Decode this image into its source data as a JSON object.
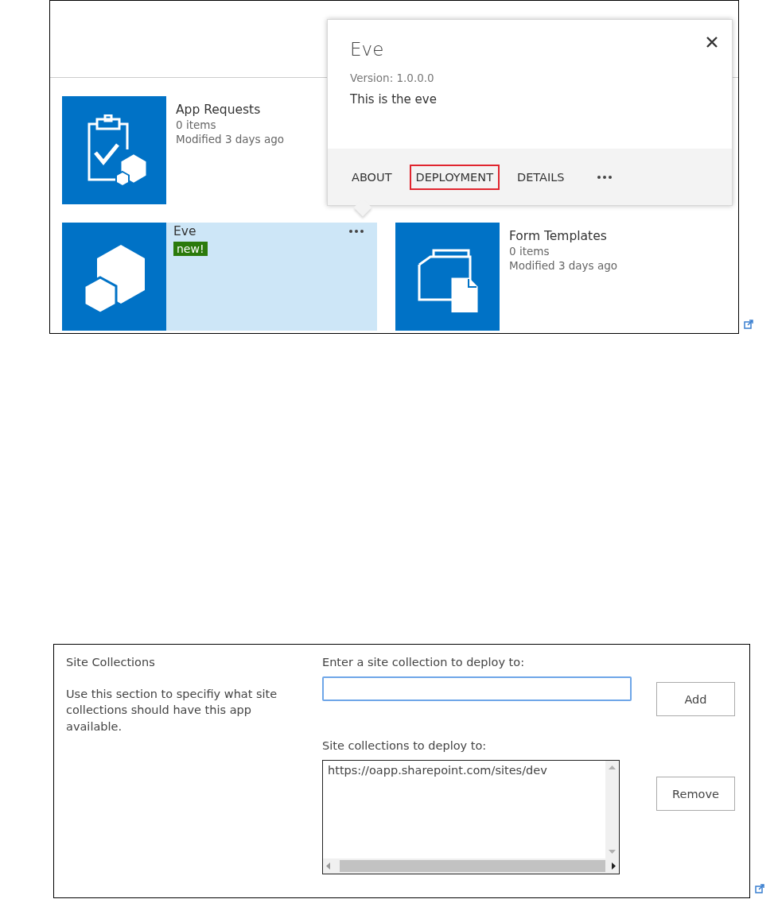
{
  "app_tiles": [
    {
      "kind": "request",
      "title": "App Requests",
      "count": "0 items",
      "modified": "Modified 3 days ago",
      "selected": false
    },
    {
      "kind": "app",
      "title": "Eve",
      "badge": "new!",
      "selected": true
    },
    {
      "kind": "folder",
      "title": "Form Templates",
      "count": "0 items",
      "modified": "Modified 3 days ago",
      "selected": false
    }
  ],
  "callout": {
    "title": "Eve",
    "version": "Version: 1.0.0.0",
    "description": "This is the eve",
    "actions": [
      {
        "label": "ABOUT",
        "highlighted": false
      },
      {
        "label": "DEPLOYMENT",
        "highlighted": true
      },
      {
        "label": "DETAILS",
        "highlighted": false
      }
    ]
  },
  "site_collections": {
    "title": "Site Collections",
    "description": "Use this section to specifiy what site collections should have this app available.",
    "entry_label": "Enter a site collection to deploy to:",
    "entry_focused": true,
    "add_button": "Add",
    "list_label": "Site collections to deploy to:",
    "list_items": [
      "https://oapp.sharepoint.com/sites/dev"
    ],
    "remove_button": "Remove"
  }
}
